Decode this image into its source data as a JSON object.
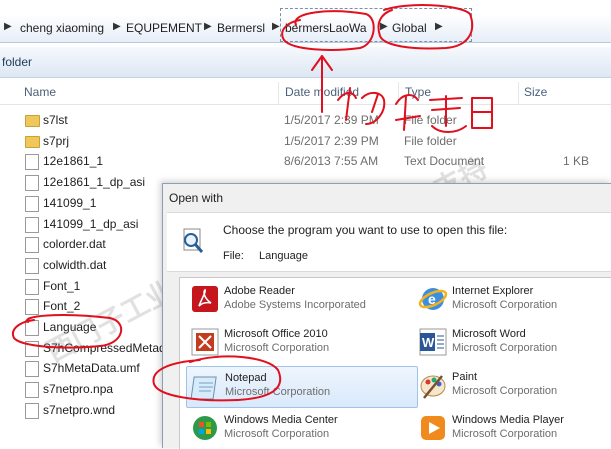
{
  "breadcrumb": {
    "items": [
      "cheng xiaoming",
      "EQUPEMENT",
      "Bermersl",
      "bermersLaoWa",
      "Global"
    ]
  },
  "commandbar": {
    "label": "folder"
  },
  "columns": {
    "name": "Name",
    "date": "Date modified",
    "type": "Type",
    "size": "Size"
  },
  "files": [
    {
      "name": "s7lst",
      "date": "1/5/2017 2:39 PM",
      "type": "File folder",
      "size": "",
      "kind": "folder"
    },
    {
      "name": "s7prj",
      "date": "1/5/2017 2:39 PM",
      "type": "File folder",
      "size": "",
      "kind": "folder"
    },
    {
      "name": "12e1861_1",
      "date": "8/6/2013 7:55 AM",
      "type": "Text Document",
      "size": "1 KB",
      "kind": "file"
    },
    {
      "name": "12e1861_1_dp_asi",
      "date": "",
      "type": "",
      "size": "",
      "kind": "file"
    },
    {
      "name": "141099_1",
      "date": "",
      "type": "",
      "size": "",
      "kind": "file"
    },
    {
      "name": "141099_1_dp_asi",
      "date": "",
      "type": "",
      "size": "",
      "kind": "file"
    },
    {
      "name": "colorder.dat",
      "date": "",
      "type": "",
      "size": "",
      "kind": "file"
    },
    {
      "name": "colwidth.dat",
      "date": "",
      "type": "",
      "size": "",
      "kind": "file"
    },
    {
      "name": "Font_1",
      "date": "",
      "type": "",
      "size": "",
      "kind": "file"
    },
    {
      "name": "Font_2",
      "date": "",
      "type": "",
      "size": "",
      "kind": "file"
    },
    {
      "name": "Language",
      "date": "",
      "type": "",
      "size": "",
      "kind": "file"
    },
    {
      "name": "S7hCompressedMetad",
      "date": "",
      "type": "",
      "size": "",
      "kind": "file"
    },
    {
      "name": "S7hMetaData.umf",
      "date": "",
      "type": "",
      "size": "",
      "kind": "file"
    },
    {
      "name": "s7netpro.npa",
      "date": "",
      "type": "",
      "size": "",
      "kind": "file"
    },
    {
      "name": "s7netpro.wnd",
      "date": "",
      "type": "",
      "size": "",
      "kind": "file"
    }
  ],
  "dialog": {
    "title": "Open with",
    "prompt": "Choose the program you want to use to open this file:",
    "file_label": "File:",
    "file_value": "Language",
    "programs": [
      {
        "name": "Adobe Reader",
        "company": "Adobe Systems Incorporated",
        "icon": "adobe-reader-icon",
        "selected": false
      },
      {
        "name": "Internet Explorer",
        "company": "Microsoft Corporation",
        "icon": "internet-explorer-icon",
        "selected": false
      },
      {
        "name": "Microsoft Office 2010",
        "company": "Microsoft Corporation",
        "icon": "office-icon",
        "selected": false
      },
      {
        "name": "Microsoft Word",
        "company": "Microsoft Corporation",
        "icon": "word-icon",
        "selected": false
      },
      {
        "name": "Notepad",
        "company": "Microsoft Corporation",
        "icon": "notepad-icon",
        "selected": true
      },
      {
        "name": "Paint",
        "company": "Microsoft Corporation",
        "icon": "paint-icon",
        "selected": false
      },
      {
        "name": "Windows Media Center",
        "company": "Microsoft Corporation",
        "icon": "media-center-icon",
        "selected": false
      },
      {
        "name": "Windows Media Player",
        "company": "Microsoft Corporation",
        "icon": "media-player-icon",
        "selected": false
      }
    ]
  },
  "annotation": {
    "color": "#e0101e"
  }
}
